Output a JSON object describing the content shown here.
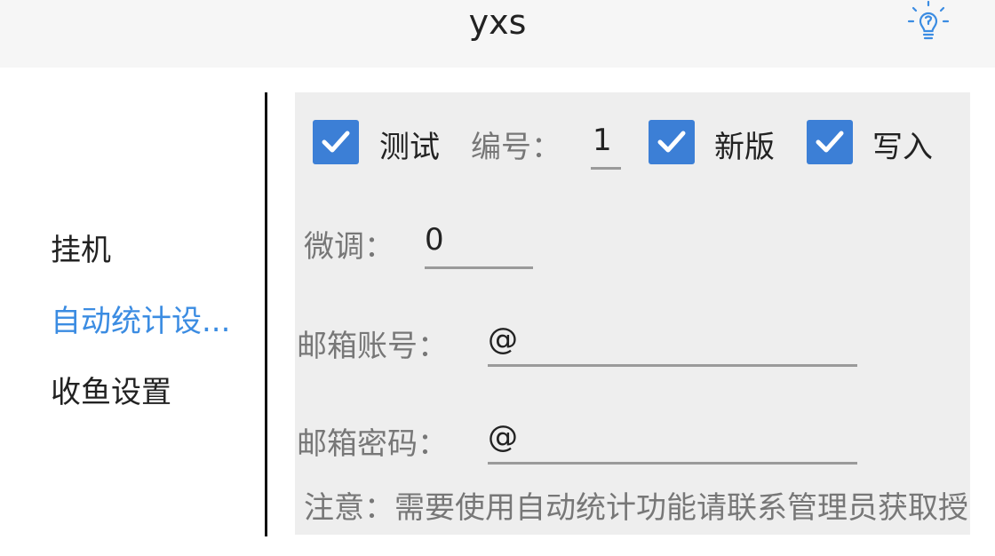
{
  "header": {
    "title": "yxs",
    "icon": "lightbulb-icon"
  },
  "sidebar": {
    "items": [
      {
        "label": "挂机",
        "active": false
      },
      {
        "label": "自动统计设...",
        "active": true
      },
      {
        "label": "收鱼设置",
        "active": false
      }
    ],
    "active_color": "#3b8ce2"
  },
  "form": {
    "test": {
      "label": "测试",
      "checked": true
    },
    "number": {
      "label": "编号：",
      "value": "1"
    },
    "new_version": {
      "label": "新版",
      "checked": true
    },
    "write": {
      "label": "写入",
      "checked": true
    },
    "fine_tune": {
      "label": "微调：",
      "value": "0"
    },
    "email_account": {
      "label": "邮箱账号：",
      "value": "@"
    },
    "email_password": {
      "label": "邮箱密码：",
      "value": "@"
    },
    "note": "注意：需要使用自动统计功能请联系管理员获取授权码(权限)"
  },
  "colors": {
    "checkbox": "#3c7fd6",
    "panel": "#eeeeee"
  }
}
